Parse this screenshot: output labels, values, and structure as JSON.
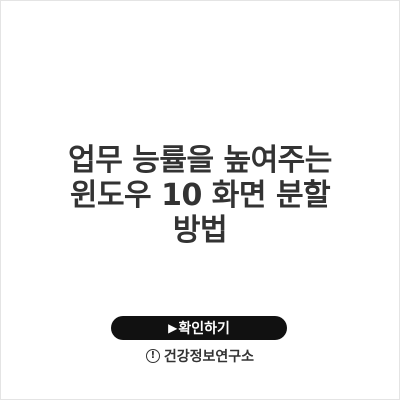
{
  "title": {
    "line1": "업무 능률을 높여주는",
    "line2": "윈도우 10 화면 분할",
    "line3": "방법"
  },
  "cta": {
    "arrow": "▶",
    "label": "확인하기"
  },
  "source": {
    "icon": "!",
    "label": "건강정보연구소"
  }
}
